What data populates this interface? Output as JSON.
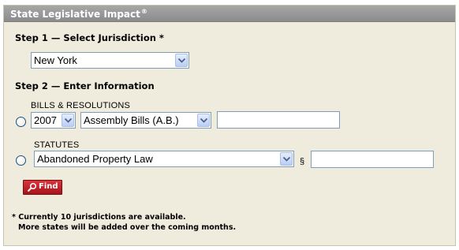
{
  "panel": {
    "title": "State Legislative Impact",
    "title_mark": "®"
  },
  "step1": {
    "heading": "Step 1 — Select Jurisdiction *",
    "jurisdiction_select": "New York"
  },
  "step2": {
    "heading": "Step 2 — Enter Information",
    "bills": {
      "label": "BILLS & RESOLUTIONS",
      "year_select": "2007",
      "type_select": "Assembly Bills (A.B.)",
      "number_value": ""
    },
    "statutes": {
      "label": "STATUTES",
      "statute_select": "Abandoned Property Law",
      "section_symbol": "§",
      "section_value": ""
    }
  },
  "find_button": {
    "label": "Find",
    "icon": "magnifier-icon"
  },
  "footnote": {
    "line1": "* Currently 10 jurisdictions are available.",
    "line2": "More states will be added over the coming months."
  },
  "colors": {
    "panel_background": "#f0ecdd",
    "header_background": "#999999",
    "button_red": "#c0202a",
    "select_border": "#7f9db9"
  }
}
